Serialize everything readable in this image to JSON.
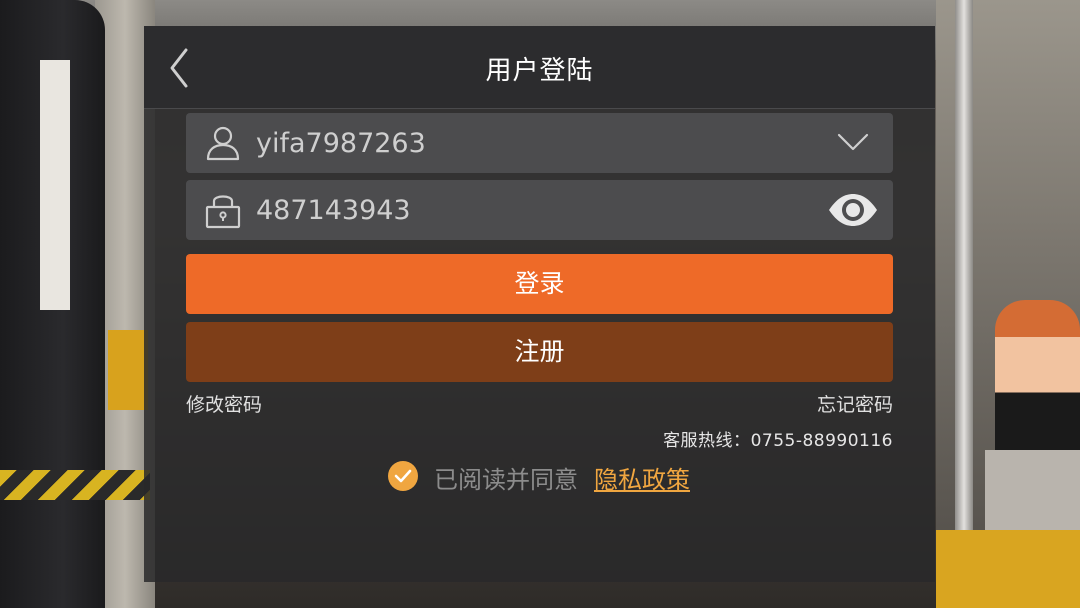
{
  "header": {
    "title": "用户登陆",
    "back_icon": "chevron-left-icon"
  },
  "form": {
    "username": {
      "icon": "user-icon",
      "value": "yifa7987263",
      "dropdown_icon": "chevron-down-icon"
    },
    "password": {
      "icon": "lock-icon",
      "value": "487143943",
      "visibility_icon": "eye-icon"
    }
  },
  "buttons": {
    "login_label": "登录",
    "register_label": "注册"
  },
  "links": {
    "modify_password": "修改密码",
    "forgot_password": "忘记密码"
  },
  "hotline": {
    "label": "客服热线：",
    "number": "0755-88990116"
  },
  "agreement": {
    "checked": true,
    "text": "已阅读并同意",
    "policy_link": "隐私政策"
  },
  "colors": {
    "accent": "#ee6a28",
    "register": "#7e3e18",
    "policy": "#f0a640"
  }
}
